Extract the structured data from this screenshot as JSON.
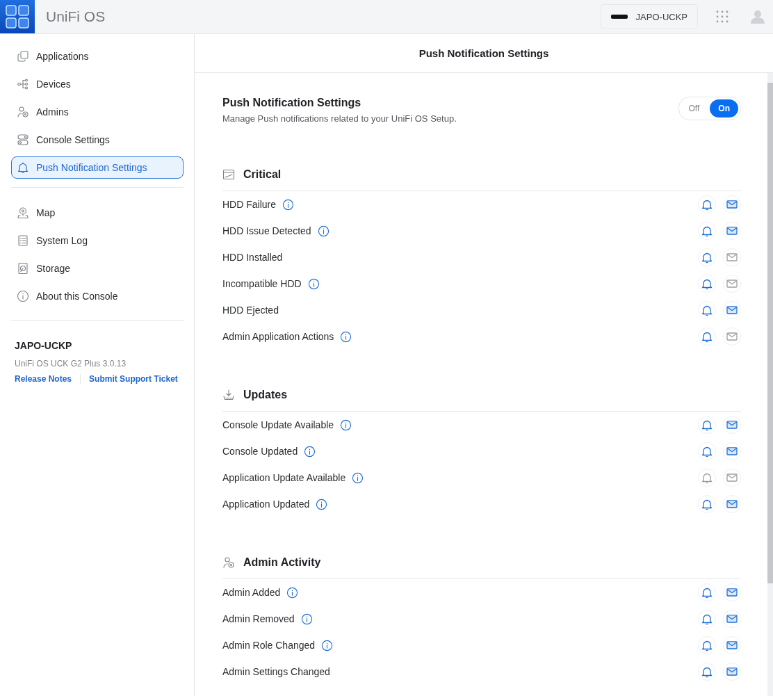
{
  "topbar": {
    "title": "UniFi OS",
    "console_button": "JAPO-UCKP"
  },
  "sidebar": {
    "items": [
      {
        "label": "Applications",
        "selected": false
      },
      {
        "label": "Devices",
        "selected": false
      },
      {
        "label": "Admins",
        "selected": false
      },
      {
        "label": "Console Settings",
        "selected": false
      },
      {
        "label": "Push Notification Settings",
        "selected": true
      }
    ],
    "items_2": [
      {
        "label": "Map",
        "selected": false
      },
      {
        "label": "System Log",
        "selected": false
      },
      {
        "label": "Storage",
        "selected": false
      },
      {
        "label": "About this Console",
        "selected": false
      }
    ],
    "console": {
      "name": "JAPO-UCKP",
      "version": "UniFi OS UCK G2 Plus 3.0.13",
      "links": [
        "Release Notes",
        "Submit Support Ticket"
      ]
    }
  },
  "main": {
    "header": "Push Notification Settings",
    "title": "Push Notification Settings",
    "subtitle": "Manage Push notifications related to your UniFi OS Setup.",
    "toggle": [
      {
        "label": "Off",
        "selected": false
      },
      {
        "label": "On",
        "selected": true
      }
    ],
    "sections": [
      {
        "title": "Critical",
        "rows": [
          {
            "label": "HDD Failure",
            "info": true,
            "push": true,
            "email": true
          },
          {
            "label": "HDD Issue Detected",
            "info": true,
            "push": true,
            "email": true
          },
          {
            "label": "HDD Installed",
            "info": false,
            "push": true,
            "email": false
          },
          {
            "label": "Incompatible HDD",
            "info": true,
            "push": true,
            "email": false
          },
          {
            "label": "HDD Ejected",
            "info": false,
            "push": true,
            "email": true
          },
          {
            "label": "Admin Application Actions",
            "info": true,
            "push": true,
            "email": false
          }
        ]
      },
      {
        "title": "Updates",
        "rows": [
          {
            "label": "Console Update Available",
            "info": true,
            "push": true,
            "email": true
          },
          {
            "label": "Console Updated",
            "info": true,
            "push": true,
            "email": true
          },
          {
            "label": "Application Update Available",
            "info": true,
            "push": false,
            "email": false
          },
          {
            "label": "Application Updated",
            "info": true,
            "push": true,
            "email": true
          }
        ]
      },
      {
        "title": "Admin Activity",
        "rows": [
          {
            "label": "Admin Added",
            "info": true,
            "push": true,
            "email": true
          },
          {
            "label": "Admin Removed",
            "info": true,
            "push": true,
            "email": true
          },
          {
            "label": "Admin Role Changed",
            "info": true,
            "push": true,
            "email": true
          },
          {
            "label": "Admin Settings Changed",
            "info": false,
            "push": true,
            "email": true
          }
        ]
      }
    ]
  }
}
